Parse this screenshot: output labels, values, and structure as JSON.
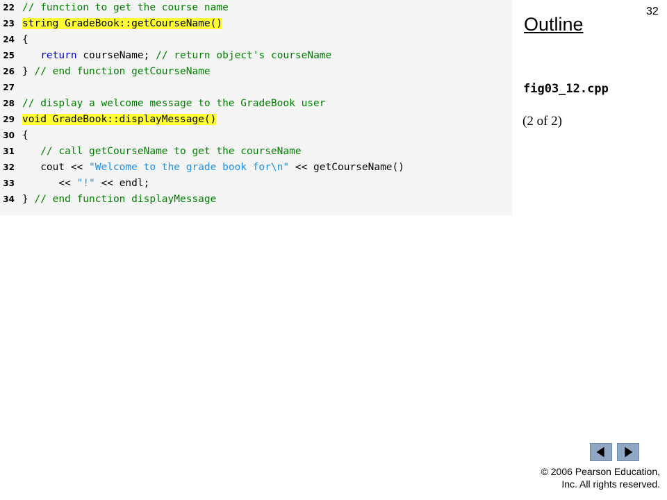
{
  "page_number": "32",
  "outline": {
    "title": "Outline",
    "file_name": "fig03_12.cpp",
    "part": "(2 of 2)"
  },
  "code": {
    "lines": [
      {
        "num": "22",
        "segments": [
          {
            "text": "// function to get the course name",
            "style": "comment"
          }
        ]
      },
      {
        "num": "23",
        "segments": [
          {
            "text": "string GradeBook::getCourseName()",
            "style": "normal highlight"
          }
        ]
      },
      {
        "num": "24",
        "segments": [
          {
            "text": "{",
            "style": "normal"
          }
        ]
      },
      {
        "num": "25",
        "segments": [
          {
            "text": "   ",
            "style": "normal"
          },
          {
            "text": "return",
            "style": "keyword"
          },
          {
            "text": " courseName; ",
            "style": "normal"
          },
          {
            "text": "// return object's courseName",
            "style": "comment"
          }
        ]
      },
      {
        "num": "26",
        "segments": [
          {
            "text": "} ",
            "style": "normal"
          },
          {
            "text": "// end function getCourseName",
            "style": "comment"
          }
        ]
      },
      {
        "num": "27",
        "segments": []
      },
      {
        "num": "28",
        "segments": [
          {
            "text": "// display a welcome message to the GradeBook user",
            "style": "comment"
          }
        ]
      },
      {
        "num": "29",
        "segments": [
          {
            "text": "void GradeBook::displayMessage()",
            "style": "normal highlight"
          }
        ]
      },
      {
        "num": "30",
        "segments": [
          {
            "text": "{",
            "style": "normal"
          }
        ]
      },
      {
        "num": "31",
        "segments": [
          {
            "text": "   ",
            "style": "normal"
          },
          {
            "text": "// call getCourseName to get the courseName",
            "style": "comment"
          }
        ]
      },
      {
        "num": "32",
        "segments": [
          {
            "text": "   cout << ",
            "style": "normal"
          },
          {
            "text": "\"Welcome to the grade book for\\n\"",
            "style": "string"
          },
          {
            "text": " << getCourseName()",
            "style": "normal"
          }
        ]
      },
      {
        "num": "33",
        "segments": [
          {
            "text": "      << ",
            "style": "normal"
          },
          {
            "text": "\"!\"",
            "style": "string"
          },
          {
            "text": " << endl;",
            "style": "normal"
          }
        ]
      },
      {
        "num": "34",
        "segments": [
          {
            "text": "} ",
            "style": "normal"
          },
          {
            "text": "// end function displayMessage",
            "style": "comment"
          }
        ]
      }
    ]
  },
  "navigation": {
    "prev_icon": "left-triangle-icon",
    "next_icon": "right-triangle-icon",
    "button_color": "#8fa7c4"
  },
  "copyright": {
    "line1": "© 2006 Pearson Education,",
    "line2": "Inc.  All rights reserved."
  }
}
